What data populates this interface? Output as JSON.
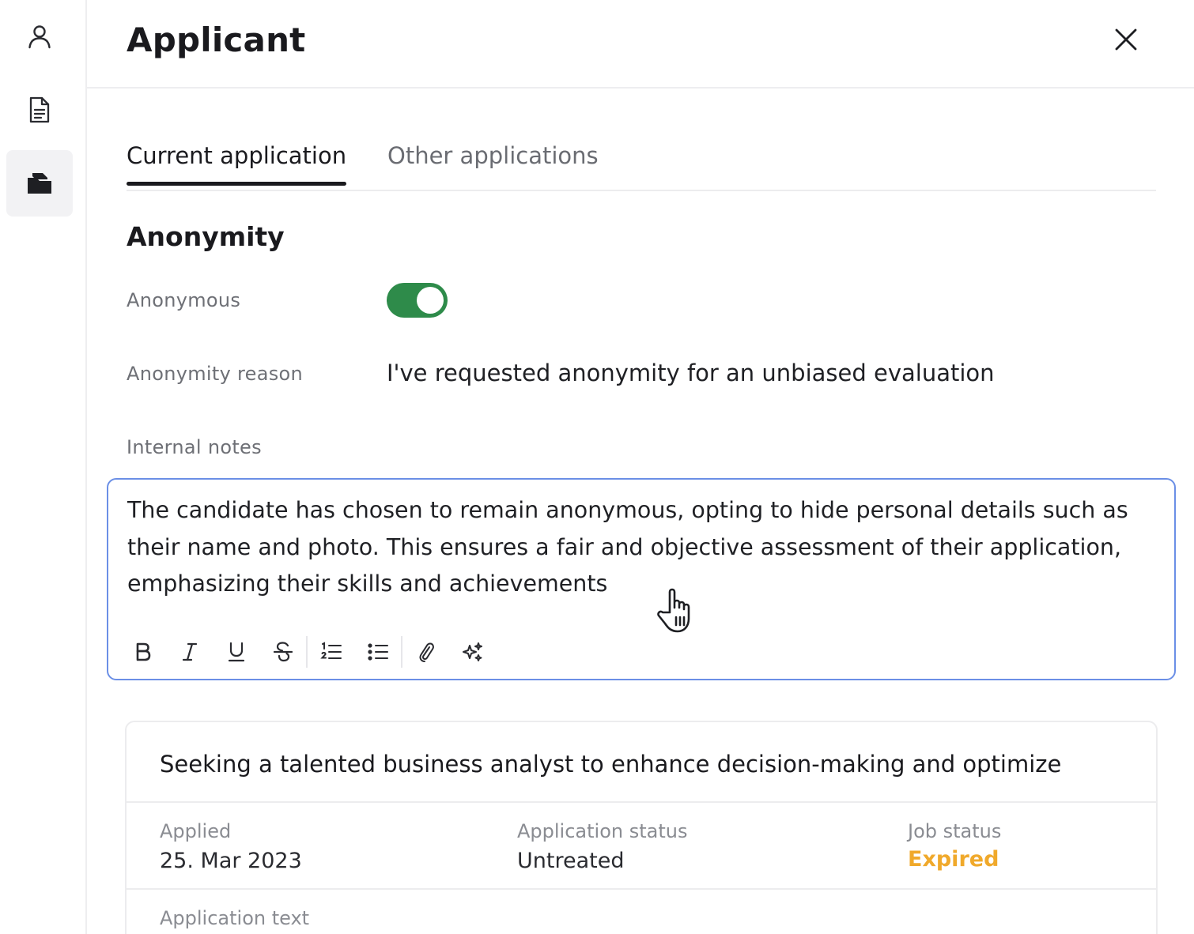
{
  "sidebar": {
    "items": [
      {
        "name": "profile",
        "icon": "person-icon",
        "active": false
      },
      {
        "name": "documents",
        "icon": "document-icon",
        "active": false
      },
      {
        "name": "applications",
        "icon": "folders-icon",
        "active": true
      }
    ]
  },
  "header": {
    "title": "Applicant",
    "close_icon": "close-icon"
  },
  "tabs": [
    {
      "label": "Current application",
      "active": true
    },
    {
      "label": "Other applications",
      "active": false
    }
  ],
  "anonymity": {
    "section_title": "Anonymity",
    "anonymous_label": "Anonymous",
    "anonymous_on": true,
    "reason_label": "Anonymity reason",
    "reason_value": "I've requested anonymity for an unbiased evaluation"
  },
  "notes": {
    "label": "Internal notes",
    "text": "The candidate has chosen to remain anonymous, opting to hide personal details such as their name and photo. This ensures a fair and objective assessment of their application, emphasizing their skills and achievements",
    "toolbar": [
      "bold-icon",
      "italic-icon",
      "underline-icon",
      "strikethrough-icon",
      "ordered-list-icon",
      "bullet-list-icon",
      "attachment-icon",
      "ai-sparkle-icon"
    ]
  },
  "job_card": {
    "title": "Seeking a talented business analyst to enhance decision-making and optimize",
    "applied_label": "Applied",
    "applied_value": "25. Mar 2023",
    "app_status_label": "Application status",
    "app_status_value": "Untreated",
    "job_status_label": "Job status",
    "job_status_value": "Expired",
    "application_text_label": "Application text"
  },
  "colors": {
    "toggle_on": "#2e8b4a",
    "editor_focus_border": "#6b8fe6",
    "expired": "#f0a92b",
    "active_rail_bg": "#f2f2f4"
  }
}
